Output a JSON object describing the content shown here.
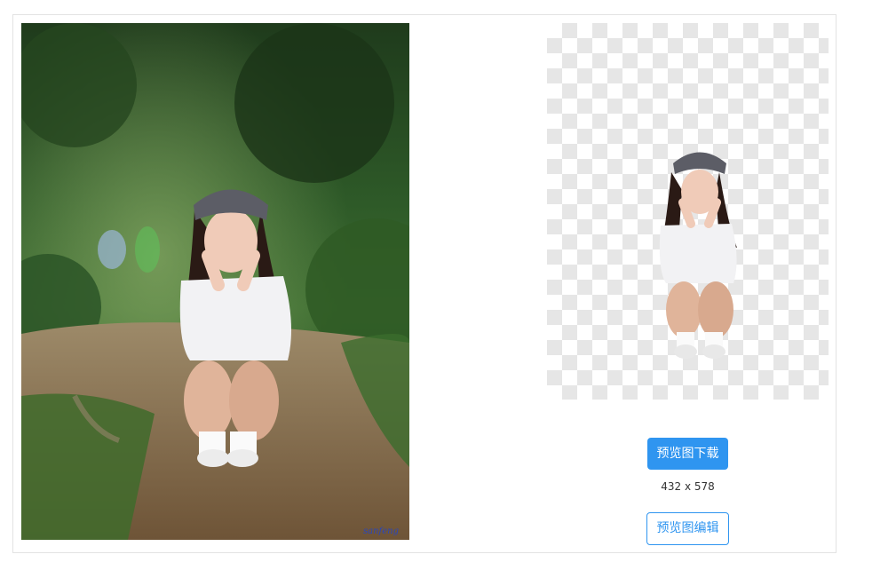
{
  "preview": {
    "original_watermark": "sanfeng",
    "download_button": "预览图下载",
    "dimensions": "432 x 578",
    "edit_button": "预览图编辑"
  }
}
